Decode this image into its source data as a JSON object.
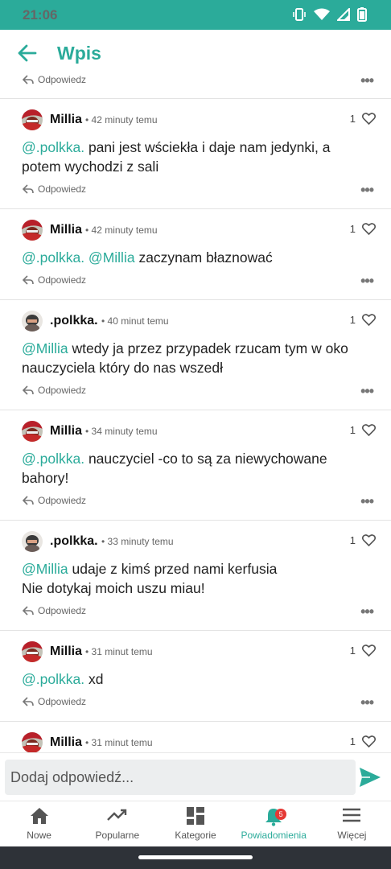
{
  "status": {
    "time": "21:06"
  },
  "header": {
    "title": "Wpis"
  },
  "reply_label": "Odpowiedz",
  "comments": [
    {
      "author": "Millia",
      "time": "• 42 minuty temu",
      "likes": "1",
      "avatar": "millia",
      "mention": "@.polkka.",
      "text": " pani jest wściekła i daje nam jedynki, a potem wychodzi z sali"
    },
    {
      "author": "Millia",
      "time": "• 42 minuty temu",
      "likes": "1",
      "avatar": "millia",
      "mention": "@.polkka. @Millia",
      "text": " zaczynam błaznować"
    },
    {
      "author": ".polkka.",
      "time": "• 40 minut temu",
      "likes": "1",
      "avatar": "polkka",
      "mention": "@Millia",
      "text": " wtedy ja przez przypadek rzucam tym w oko nauczyciela który do nas wszedł"
    },
    {
      "author": "Millia",
      "time": "• 34 minuty temu",
      "likes": "1",
      "avatar": "millia",
      "mention": "@.polkka.",
      "text": " nauczyciel -co to są za niewychowane bahory!"
    },
    {
      "author": ".polkka.",
      "time": "• 33 minuty temu",
      "likes": "1",
      "avatar": "polkka",
      "mention": "@Millia",
      "text": " udaje z kimś przed nami kerfusia",
      "text2": "Nie dotykaj moich uszu miau!"
    },
    {
      "author": "Millia",
      "time": "• 31 minut temu",
      "likes": "1",
      "avatar": "millia",
      "mention": "@.polkka.",
      "text": " xd"
    },
    {
      "author": "Millia",
      "time": "• 31 minut temu",
      "likes": "1",
      "avatar": "millia",
      "mention": "",
      "text": ""
    }
  ],
  "composer": {
    "placeholder": "Dodaj odpowiedź..."
  },
  "nav": {
    "items": [
      {
        "label": "Nowe",
        "icon": "home-icon"
      },
      {
        "label": "Popularne",
        "icon": "trending-icon"
      },
      {
        "label": "Kategorie",
        "icon": "categories-icon"
      },
      {
        "label": "Powiadomienia",
        "icon": "bell-icon",
        "badge": "5"
      },
      {
        "label": "Więcej",
        "icon": "menu-icon"
      }
    ]
  },
  "colors": {
    "accent": "#2bab9a",
    "badge": "#e53935"
  }
}
